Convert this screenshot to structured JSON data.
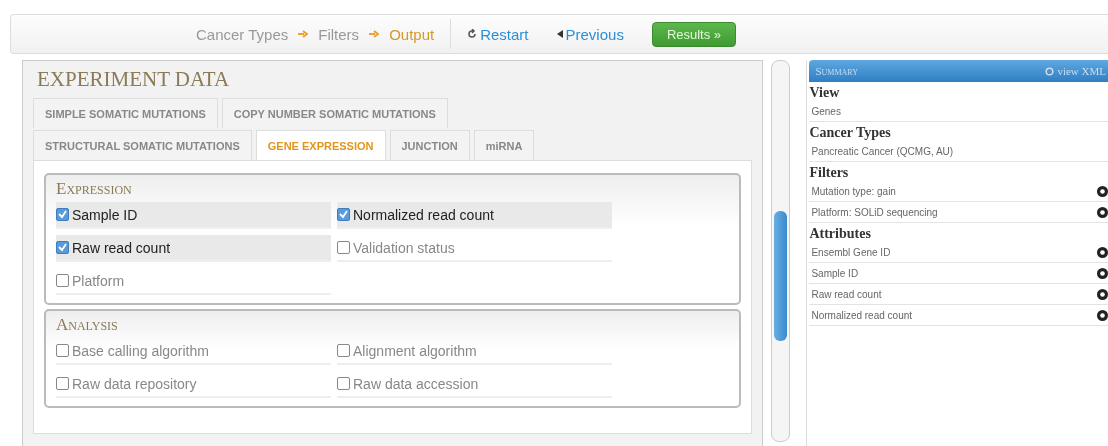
{
  "breadcrumb": [
    {
      "label": "Cancer Types",
      "selected": false
    },
    {
      "label": "Filters",
      "selected": false
    },
    {
      "label": "Output",
      "selected": true
    }
  ],
  "nav": {
    "restart": "Restart",
    "previous": "Previous",
    "results": "Results »"
  },
  "panel": {
    "title": "EXPERIMENT DATA",
    "tab_rows": [
      [
        {
          "label": "SIMPLE SOMATIC MUTATIONS",
          "selected": false
        },
        {
          "label": "COPY NUMBER SOMATIC MUTATIONS",
          "selected": false
        }
      ],
      [
        {
          "label": "STRUCTURAL SOMATIC MUTATIONS",
          "selected": false
        },
        {
          "label": "GENE EXPRESSION",
          "selected": true
        },
        {
          "label": "JUNCTION",
          "selected": false
        },
        {
          "label": "miRNA",
          "selected": false
        }
      ]
    ],
    "sections": [
      {
        "title": "Expression",
        "options": [
          {
            "label": "Sample ID",
            "checked": true
          },
          {
            "label": "Normalized read count",
            "checked": true
          },
          {
            "label": "Raw read count",
            "checked": true
          },
          {
            "label": "Validation status",
            "checked": false
          },
          {
            "label": "Platform",
            "checked": false
          }
        ]
      },
      {
        "title": "Analysis",
        "options": [
          {
            "label": "Base calling algorithm",
            "checked": false
          },
          {
            "label": "Alignment algorithm",
            "checked": false
          },
          {
            "label": "Raw data repository",
            "checked": false
          },
          {
            "label": "Raw data accession",
            "checked": false
          }
        ]
      }
    ]
  },
  "summary": {
    "title": "Summary",
    "view_xml": "view XML",
    "groups": [
      {
        "heading": "View",
        "items": [
          {
            "label": "Genes",
            "removable": false
          }
        ]
      },
      {
        "heading": "Cancer Types",
        "items": [
          {
            "label": "Pancreatic Cancer (QCMG, AU)",
            "removable": false
          }
        ]
      },
      {
        "heading": "Filters",
        "items": [
          {
            "label": "Mutation type: gain",
            "removable": true
          },
          {
            "label": "Platform: SOLiD sequencing",
            "removable": true
          }
        ]
      },
      {
        "heading": "Attributes",
        "items": [
          {
            "label": "Ensembl Gene ID",
            "removable": true
          },
          {
            "label": "Sample ID",
            "removable": true
          },
          {
            "label": "Raw read count",
            "removable": true
          },
          {
            "label": "Normalized read count",
            "removable": true
          }
        ]
      }
    ]
  }
}
